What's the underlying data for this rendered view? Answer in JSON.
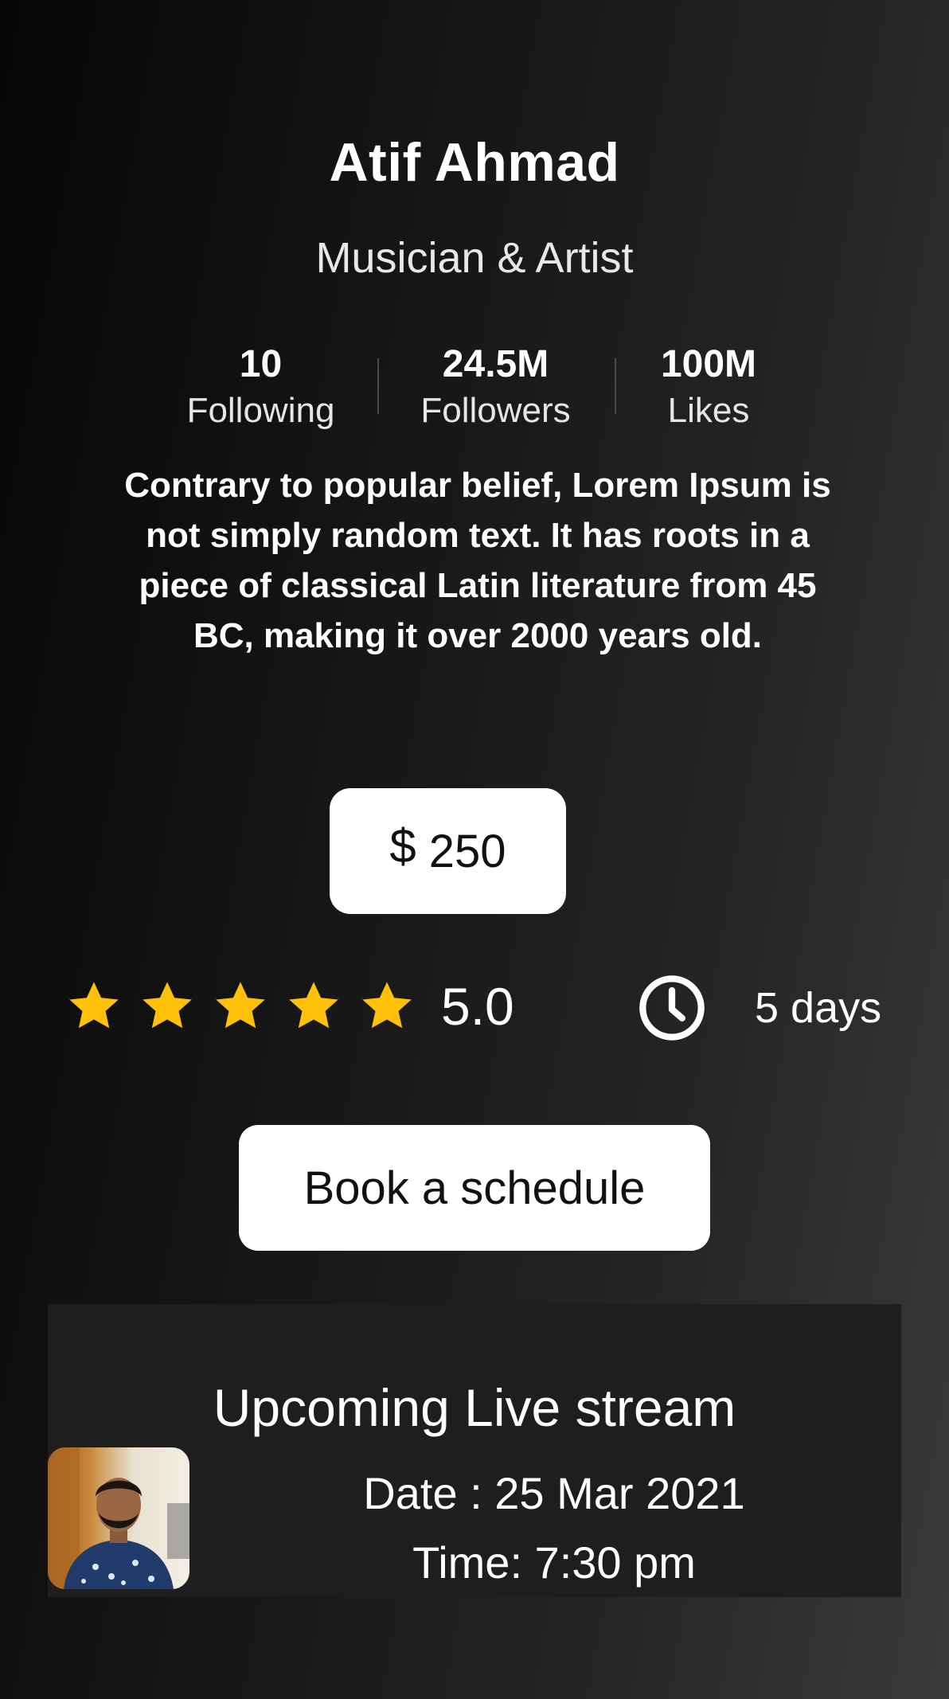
{
  "profile": {
    "name": "Atif Ahmad",
    "role": "Musician & Artist",
    "bio": "Contrary to popular belief, Lorem Ipsum is not simply random text. It has roots in a piece of classical Latin literature from 45 BC, making it over 2000 years old."
  },
  "stats": [
    {
      "value": "10",
      "label": "Following"
    },
    {
      "value": "24.5M",
      "label": "Followers"
    },
    {
      "value": "100M",
      "label": "Likes"
    }
  ],
  "price": {
    "currency": "$",
    "amount": "250"
  },
  "rating": {
    "value": "5.0",
    "stars": 5,
    "max": 5,
    "star_color": "#FFC107"
  },
  "duration": {
    "icon": "clock-icon",
    "label": "5 days"
  },
  "book_button_label": "Book a schedule",
  "live_stream": {
    "title": "Upcoming Live stream",
    "date": "Date : 25 Mar 2021",
    "time": "Time: 7:30 pm"
  },
  "colors": {
    "accent": "#FFC107",
    "card_bg": "#1E1E1E",
    "button_bg": "#FFFFFF"
  }
}
